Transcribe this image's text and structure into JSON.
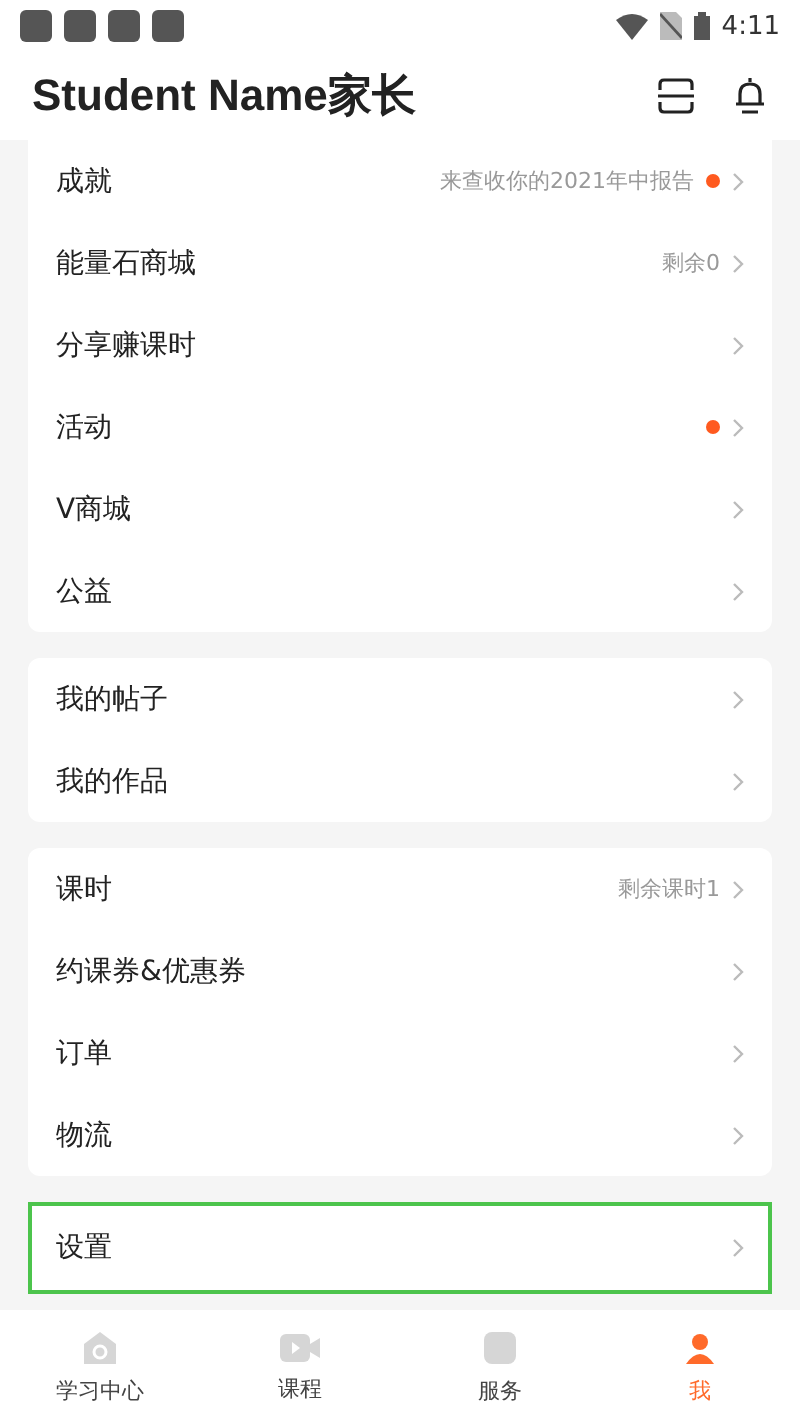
{
  "status_bar": {
    "time": "4:11"
  },
  "header": {
    "title": "Student Name家长"
  },
  "groups": [
    {
      "items": [
        {
          "label": "成就",
          "detail": "来查收你的2021年中报告",
          "dot": true,
          "selected": false
        },
        {
          "label": "能量石商城",
          "detail": "剩余0",
          "dot": false,
          "selected": false
        },
        {
          "label": "分享赚课时",
          "dot": false,
          "selected": false
        },
        {
          "label": "活动",
          "dot": true,
          "selected": false
        },
        {
          "label": "V商城",
          "dot": false,
          "selected": false
        },
        {
          "label": "公益",
          "dot": false,
          "selected": false
        }
      ]
    },
    {
      "items": [
        {
          "label": "我的帖子",
          "dot": false,
          "selected": false
        },
        {
          "label": "我的作品",
          "dot": false,
          "selected": false
        }
      ]
    },
    {
      "items": [
        {
          "label": "课时",
          "detail": "剩余课时1",
          "dot": false,
          "selected": false
        },
        {
          "label": "约课券&优惠券",
          "dot": false,
          "selected": false
        },
        {
          "label": "订单",
          "dot": false,
          "selected": false
        },
        {
          "label": "物流",
          "dot": false,
          "selected": false
        }
      ]
    },
    {
      "items": [
        {
          "label": "设置",
          "dot": false,
          "selected": true
        }
      ]
    }
  ],
  "tabs": [
    {
      "label": "学习中心",
      "kind": "home",
      "selected": false
    },
    {
      "label": "课程",
      "kind": "video",
      "selected": false
    },
    {
      "label": "服务",
      "kind": "service",
      "selected": false
    },
    {
      "label": "我",
      "kind": "me",
      "selected": true
    }
  ]
}
